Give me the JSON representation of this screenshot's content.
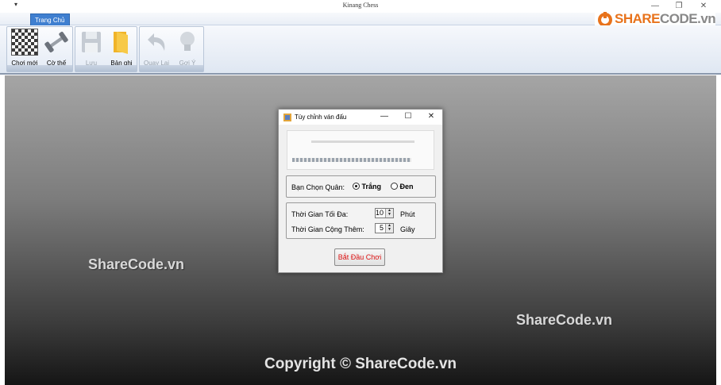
{
  "window": {
    "title": "Kinang Chess",
    "qa_icon": "▾"
  },
  "window_controls": {
    "minimize": "—",
    "restore": "❐",
    "close": "✕"
  },
  "ribbon": {
    "tab_home": "Trang Chủ",
    "buttons": {
      "new_game": "Chơi mới",
      "chess_type": "Cờ thế",
      "save": "Lưu",
      "records": "Bản ghi",
      "undo": "Quay Lại",
      "hint": "Gợi Ý"
    }
  },
  "logo": {
    "text_left": "SHARE",
    "text_right": "CODE.vn"
  },
  "watermarks": [
    "ShareCode.vn",
    "ShareCode.vn"
  ],
  "copyright": "Copyright © ShareCode.vn",
  "dialog": {
    "title": "Tùy chỉnh ván đấu",
    "controls": {
      "minimize": "—",
      "maximize": "☐",
      "close": "✕"
    },
    "side": {
      "label": "Bạn Chọn Quân:",
      "options": [
        "Trắng",
        "Đen"
      ],
      "selected": "Trắng"
    },
    "time": {
      "max_label": "Thời Gian Tối Đa:",
      "max_value": "10",
      "max_unit": "Phút",
      "add_label": "Thời Gian Cộng Thêm:",
      "add_value": "5",
      "add_unit": "Giây"
    },
    "start_button": "Bắt Đầu Chơi"
  },
  "colors": {
    "accent_tab": "#3f7fd0",
    "start_text": "#dd1111",
    "logo_orange": "#e8731c"
  }
}
